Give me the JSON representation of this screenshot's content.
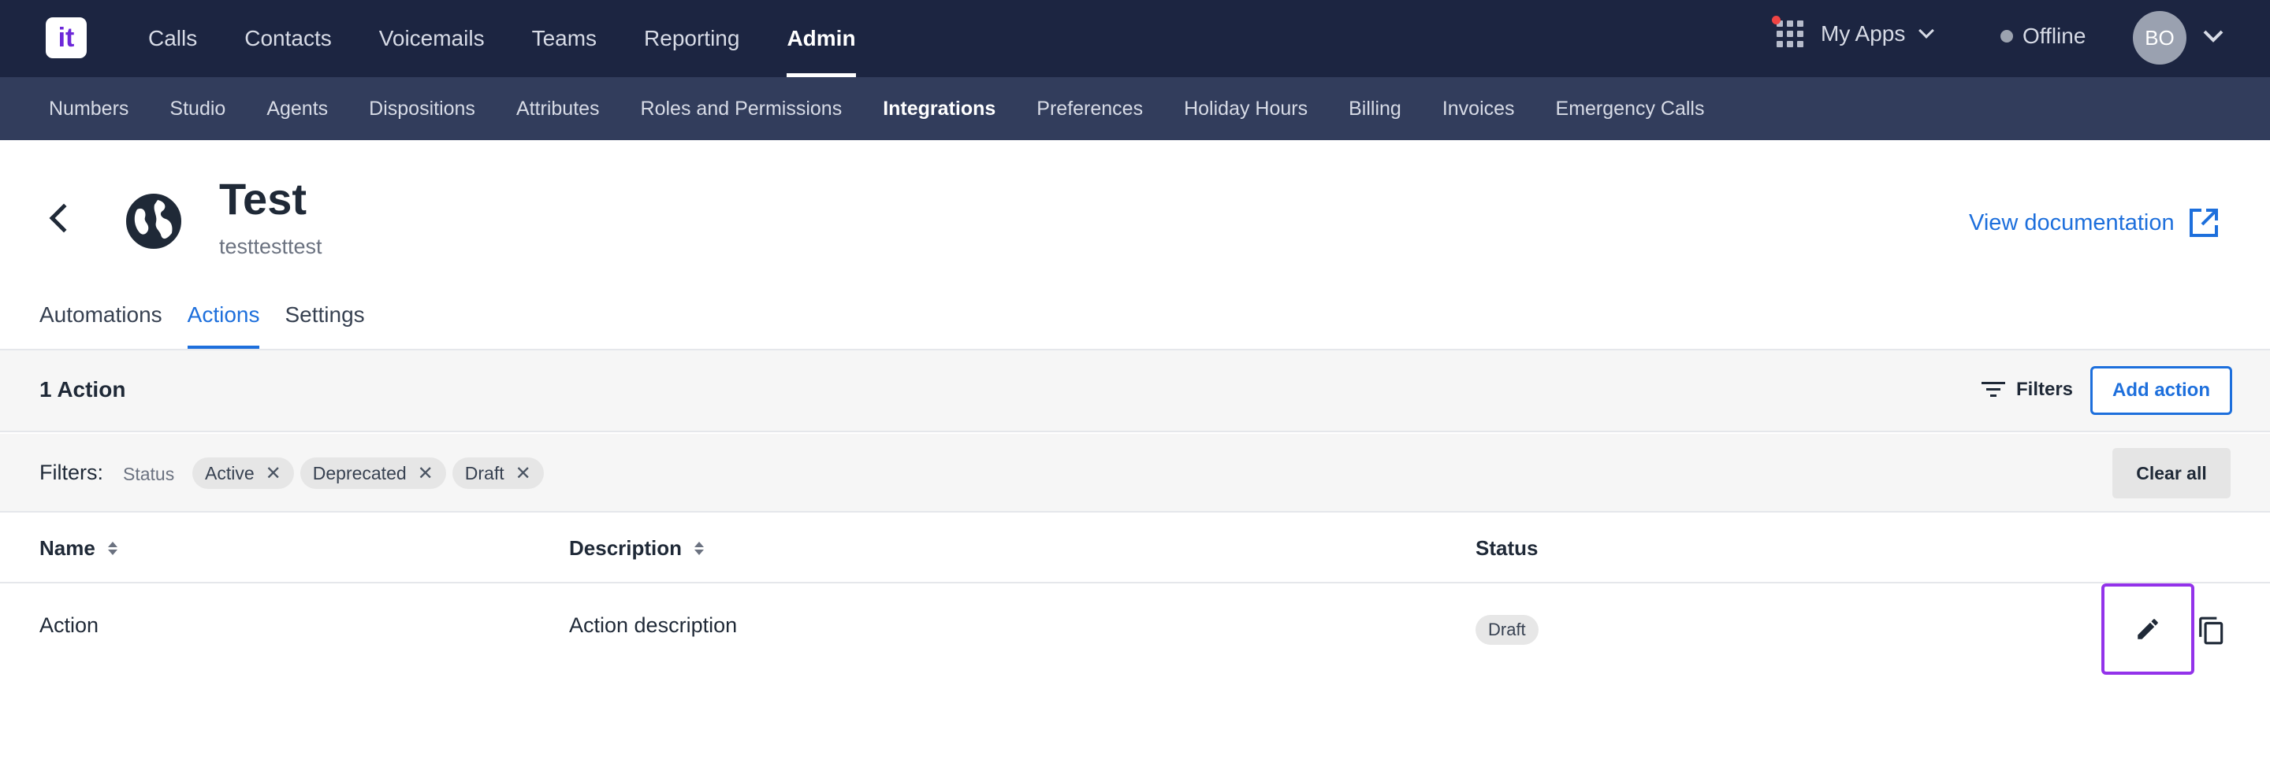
{
  "topbar": {
    "logo_text": "it",
    "nav": [
      {
        "label": "Calls"
      },
      {
        "label": "Contacts"
      },
      {
        "label": "Voicemails"
      },
      {
        "label": "Teams"
      },
      {
        "label": "Reporting"
      },
      {
        "label": "Admin",
        "active": true
      }
    ],
    "apps_label": "My Apps",
    "status_label": "Offline",
    "avatar_initials": "BO"
  },
  "subnav": [
    {
      "label": "Numbers"
    },
    {
      "label": "Studio"
    },
    {
      "label": "Agents"
    },
    {
      "label": "Dispositions"
    },
    {
      "label": "Attributes"
    },
    {
      "label": "Roles and Permissions"
    },
    {
      "label": "Integrations",
      "active": true
    },
    {
      "label": "Preferences"
    },
    {
      "label": "Holiday Hours"
    },
    {
      "label": "Billing"
    },
    {
      "label": "Invoices"
    },
    {
      "label": "Emergency Calls"
    }
  ],
  "header": {
    "title": "Test",
    "subtitle": "testtesttest",
    "view_documentation": "View documentation"
  },
  "tabs": [
    {
      "label": "Automations"
    },
    {
      "label": "Actions",
      "active": true
    },
    {
      "label": "Settings"
    }
  ],
  "toolbar": {
    "count_label": "1 Action",
    "filters_label": "Filters",
    "add_label": "Add action"
  },
  "filters": {
    "label": "Filters:",
    "group_label": "Status",
    "chips": [
      "Active",
      "Deprecated",
      "Draft"
    ],
    "clear_all": "Clear all"
  },
  "table": {
    "columns": [
      "Name",
      "Description",
      "Status"
    ],
    "rows": [
      {
        "name": "Action",
        "description": "Action description",
        "status": "Draft"
      }
    ]
  },
  "colors": {
    "topbar": "#1c2541",
    "subnav": "#323d5c",
    "accent": "#1d6fdc",
    "highlight": "#9333ea"
  },
  "icons": {
    "back": "chevron-left-icon",
    "integration": "globe-icon",
    "external": "external-link-icon",
    "filter": "filter-icon",
    "edit": "pencil-icon",
    "copy": "copy-icon"
  }
}
